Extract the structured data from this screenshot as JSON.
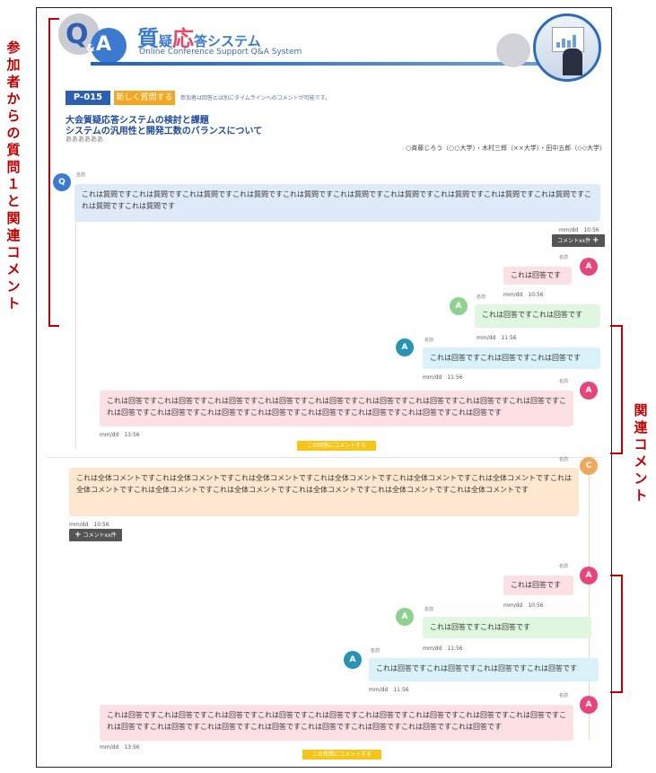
{
  "header": {
    "logo_q": "Q",
    "logo_amp": "&",
    "logo_a": "A",
    "title_main": "質",
    "title_mid": "疑",
    "title_hl": "応",
    "title_rest": "答システム",
    "subtitle": "Online Conference Support Q&A System"
  },
  "paper": {
    "number": "P-015",
    "new_question_button": "新しく質問する",
    "note": "参加者は回答とは別にタイムラインへのコメントが可能です。",
    "title_line1": "大会質疑応答システムの検討と課題",
    "title_line2": "システムの汎用性と開発工数のバランスについて",
    "extra": "ああああああ",
    "authors": "○斉藤じろう（○○大学）・木村三郎（××大学）・田中五郎（◇◇大学）"
  },
  "thread1": {
    "question": {
      "avatar": "Q",
      "name": "名前",
      "text": "これは質問ですこれは質問ですこれは質問ですこれは質問ですこれは質問ですこれは質問ですこれは質問ですこれは質問ですこれは質問ですこれは質問ですこれは質問ですこれは質問です",
      "time": "mm/dd　10:56",
      "comment_button": "コメントxx件"
    },
    "replies": [
      {
        "avatar": "A",
        "name": "名前",
        "text": "これは回答です",
        "time": "mm/dd　10:56"
      },
      {
        "avatar": "A",
        "name": "名前",
        "text": "これは回答ですこれは回答です",
        "time": "mm/dd　11:56"
      },
      {
        "avatar": "A",
        "name": "名前",
        "text": "これは回答ですこれは回答ですこれは回答です",
        "time": "mm/dd　11:56"
      },
      {
        "avatar": "A",
        "name": "名前",
        "text": "これは回答ですこれは回答ですこれは回答ですこれは回答ですこれは回答ですこれは回答ですこれは回答ですこれは回答ですこれは回答ですこれは回答ですこれは回答ですこれは回答ですこれは回答ですこれは回答ですこれは回答ですこれは回答ですこれは回答です",
        "time": "mm/dd　13:56"
      }
    ],
    "comment_action": "この回答にコメントする"
  },
  "thread2": {
    "question": {
      "avatar": "C",
      "name": "名前",
      "text": "これは全体コメントですこれは全体コメントですこれは全体コメントですこれは全体コメントですこれは全体コメントですこれは全体コメントですこれは全体コメントですこれは全体コメントですこれは全体コメントですこれは全体コメントですこれは全体コメントですこれは全体コメントです",
      "time": "mm/dd　10:56",
      "comment_button": "コメントxx件"
    },
    "replies": [
      {
        "avatar": "A",
        "name": "名前",
        "text": "これは回答です",
        "time": "mm/dd　10:56"
      },
      {
        "avatar": "A",
        "name": "名前",
        "text": "これは回答ですこれは回答です",
        "time": "mm/dd　11:56"
      },
      {
        "avatar": "A",
        "name": "名前",
        "text": "これは回答ですこれは回答ですこれは回答ですこれは回答です",
        "time": "mm/dd　11:56"
      },
      {
        "avatar": "A",
        "name": "名前",
        "text": "これは回答ですこれは回答ですこれは回答ですこれは回答ですこれは回答ですこれは回答ですこれは回答ですこれは回答ですこれは回答ですこれは回答ですこれは回答ですこれは回答ですこれは回答ですこれは回答ですこれは回答ですこれは回答ですこれは回答です",
        "time": "mm/dd　13:56"
      }
    ],
    "comment_action": "この質問にコメントする"
  },
  "annotations": {
    "left": "参加者からの質問１と関連コメント",
    "right": "関連コメント"
  },
  "colors": {
    "brand_blue": "#2a5fb2",
    "accent_orange": "#f5a623",
    "reply_pink": "#e8467a",
    "reply_green": "#8fd18f",
    "reply_teal": "#2a93b3",
    "annotation_red": "#c00000"
  }
}
